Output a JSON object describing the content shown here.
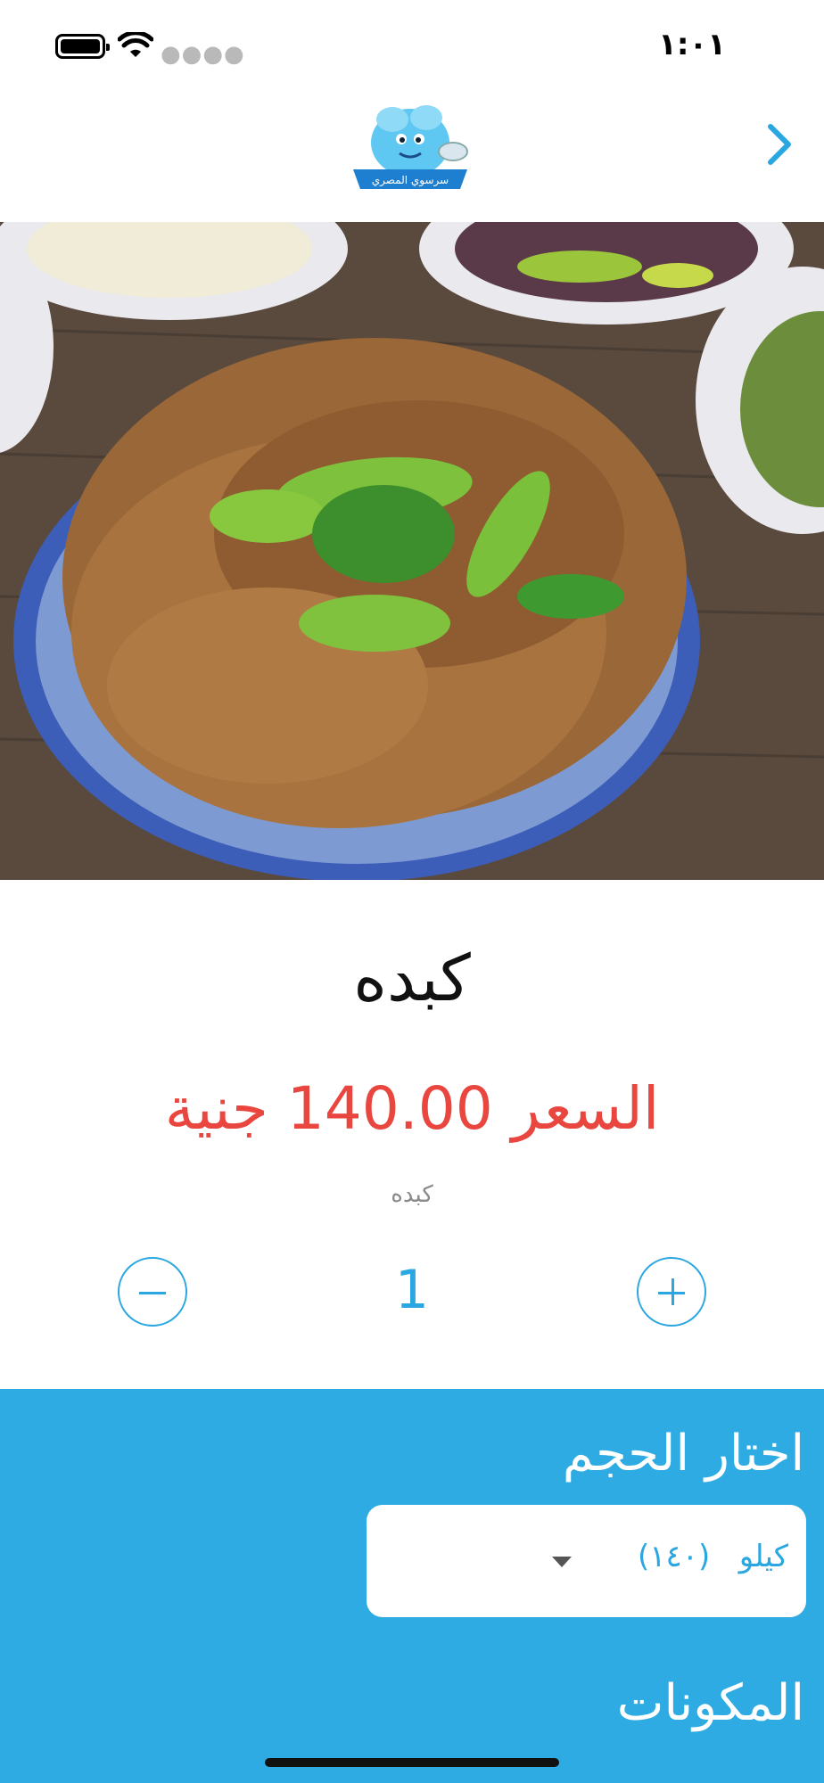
{
  "status_bar": {
    "time": "١:٠١",
    "signal": "●●●●"
  },
  "header": {
    "logo_text": "سرسوي المصري"
  },
  "product": {
    "name": "كبده",
    "price": "السعر 140.00 جنية",
    "description": "كبده",
    "quantity": "1"
  },
  "options": {
    "size_heading": "اختار الحجم",
    "size_selected": "كيلو   (١٤٠)",
    "components_heading": "المكونات"
  },
  "colors": {
    "accent": "#2eabe3",
    "price": "#e8463e"
  },
  "icons": {
    "back": "chevron-right-icon",
    "minus": "minus-circle-icon",
    "plus": "plus-circle-icon",
    "caret": "caret-down-icon"
  }
}
